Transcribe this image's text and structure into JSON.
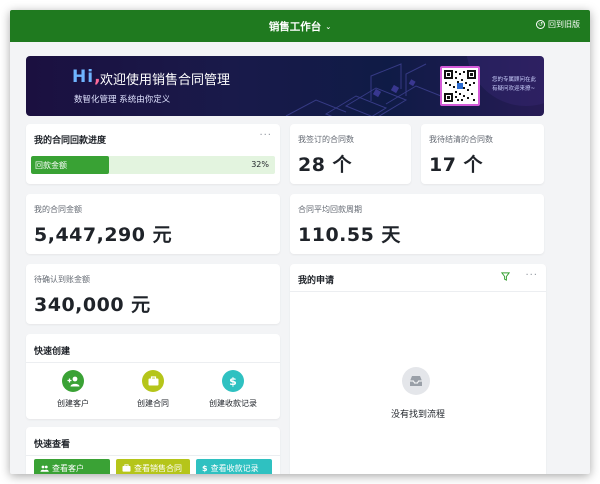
{
  "topbar": {
    "title": "销售工作台",
    "back_label": "回到旧版"
  },
  "banner": {
    "hi": "Hi",
    "comma": ",",
    "title": "欢迎使用销售合同管理",
    "subtitle": "数智化管理 系统由你定义",
    "qr_text": "您的专属顾问在此 有疑问欢迎来撩~"
  },
  "progress_card": {
    "title": "我的合同回款进度",
    "bar_label": "回款金额",
    "percent": 32,
    "percent_label": "32%"
  },
  "stats": {
    "signed": {
      "label": "我签订的合同数",
      "value": "28 个"
    },
    "pending": {
      "label": "我待结清的合同数",
      "value": "17 个"
    },
    "amount": {
      "label": "我的合同金额",
      "value": "5,447,290 元"
    },
    "cycle": {
      "label": "合同平均回款周期",
      "value": "110.55 天"
    },
    "to_confirm": {
      "label": "待确认到账金额",
      "value": "340,000 元"
    }
  },
  "quick_create": {
    "title": "快速创建",
    "items": [
      {
        "label": "创建客户",
        "color": "#3aa235",
        "icon": "add-user-icon"
      },
      {
        "label": "创建合同",
        "color": "#b5c51a",
        "icon": "briefcase-icon"
      },
      {
        "label": "创建收款记录",
        "color": "#2fc1c1",
        "icon": "dollar-icon"
      }
    ]
  },
  "quick_view": {
    "title": "快速查看",
    "items": [
      {
        "label": "查看客户",
        "color": "#3aa235",
        "icon": "users-icon"
      },
      {
        "label": "查看销售合同",
        "color": "#b5c51a",
        "icon": "briefcase-icon"
      },
      {
        "label": "查看收款记录",
        "color": "#2fc1c1",
        "icon": "dollar-icon"
      }
    ]
  },
  "my_requests": {
    "title": "我的申请",
    "empty_text": "没有找到流程"
  },
  "colors": {
    "brand": "#1f7a1f",
    "accent": "#39a234"
  }
}
